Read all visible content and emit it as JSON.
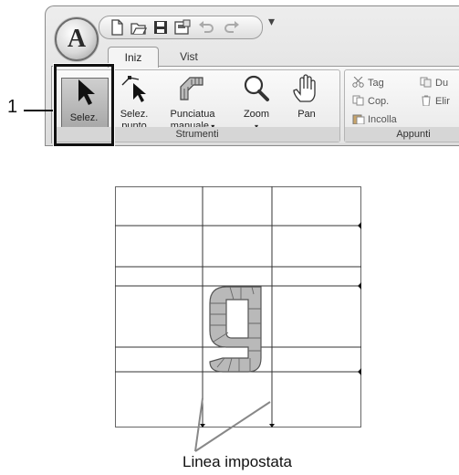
{
  "ribbon": {
    "app_button_letter": "A",
    "quick_access_icons": [
      "new-document-icon",
      "open-folder-icon",
      "save-icon",
      "save-as-icon",
      "undo-icon",
      "redo-icon"
    ],
    "tabs": [
      {
        "label": "Iniz",
        "active": true
      },
      {
        "label": "Vist",
        "active": false
      }
    ],
    "groups": {
      "strumenti": {
        "label": "Strumenti",
        "buttons": [
          {
            "label": "Selez.",
            "icon": "arrow-cursor-icon",
            "has_dropdown": true,
            "selected": true
          },
          {
            "label_line1": "Selez.",
            "label_line2": "punto",
            "icon": "select-point-icon"
          },
          {
            "label_line1": "Punciatua",
            "label_line2": "manuale",
            "icon": "manual-punch-icon",
            "has_dropdown": true
          },
          {
            "label": "Zoom",
            "icon": "magnifier-icon",
            "has_dropdown": true
          },
          {
            "label": "Pan",
            "icon": "hand-icon"
          }
        ]
      },
      "appunti": {
        "label": "Appunti",
        "items": [
          {
            "label": "Tag",
            "icon": "scissors-icon"
          },
          {
            "label": "Cop.",
            "icon": "copy-icon"
          },
          {
            "label": "Incolla",
            "icon": "paste-icon"
          },
          {
            "label": "Du",
            "icon": "duplicate-icon"
          },
          {
            "label": "Elir",
            "icon": "delete-icon"
          }
        ]
      }
    }
  },
  "callout": {
    "number": "1"
  },
  "annotation": {
    "text": "Linea impostata"
  },
  "colors": {
    "glyph_fill": "#b9b9b9",
    "glyph_stroke": "#555555",
    "grid_line": "#333333"
  }
}
